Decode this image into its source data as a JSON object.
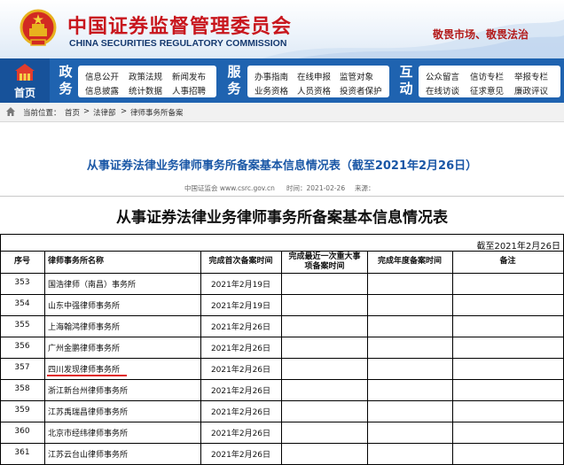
{
  "header": {
    "title_cn": "中国证券监督管理委员会",
    "title_en": "CHINA SECURITIES REGULATORY COMMISSION",
    "slogan": "敬畏市场、敬畏法治"
  },
  "nav": {
    "home_label": "首页",
    "groups": [
      {
        "category": [
          "政",
          "务"
        ],
        "links": [
          "信息公开",
          "政策法规",
          "新闻发布",
          "信息披露",
          "统计数据",
          "人事招聘"
        ]
      },
      {
        "category": [
          "服",
          "务"
        ],
        "links": [
          "办事指南",
          "在线申报",
          "监管对象",
          "业务资格",
          "人员资格",
          "投资者保护"
        ]
      },
      {
        "category": [
          "互",
          "动"
        ],
        "links": [
          "公众留言",
          "信访专栏",
          "举报专栏",
          "在线访谈",
          "征求意见",
          "廉政评议"
        ]
      }
    ]
  },
  "breadcrumb": {
    "items": [
      "当前位置：",
      "首页",
      ">",
      "法律部",
      ">",
      "律师事务所备案"
    ]
  },
  "article": {
    "title": "从事证券法律业务律师事务所备案基本信息情况表（截至2021年2月26日）",
    "source": "中国证监会 www.csrc.gov.cn",
    "time": "时间：2021-02-26",
    "from": "来源："
  },
  "table": {
    "title": "从事证券法律业务律师事务所备案基本信息情况表",
    "as_of": "截至2021年2月26日",
    "headers": [
      "序号",
      "律师事务所名称",
      "完成首次备案时间",
      "完成最近一次重大事项备案时间",
      "完成年度备案时间",
      "备注"
    ],
    "rows": [
      {
        "no": "353",
        "name": "国浩律师（南昌）事务所",
        "first": "2021年2月19日",
        "recent": "",
        "annual": "",
        "note": ""
      },
      {
        "no": "354",
        "name": "山东中强律师事务所",
        "first": "2021年2月19日",
        "recent": "",
        "annual": "",
        "note": ""
      },
      {
        "no": "355",
        "name": "上海翰鸿律师事务所",
        "first": "2021年2月26日",
        "recent": "",
        "annual": "",
        "note": ""
      },
      {
        "no": "356",
        "name": "广州金鹏律师事务所",
        "first": "2021年2月26日",
        "recent": "",
        "annual": "",
        "note": ""
      },
      {
        "no": "357",
        "name": "四川发现律师事务所",
        "first": "2021年2月26日",
        "recent": "",
        "annual": "",
        "note": ""
      },
      {
        "no": "358",
        "name": "浙江新台州律师事务所",
        "first": "2021年2月26日",
        "recent": "",
        "annual": "",
        "note": ""
      },
      {
        "no": "359",
        "name": "江苏禹瑞昌律师事务所",
        "first": "2021年2月26日",
        "recent": "",
        "annual": "",
        "note": ""
      },
      {
        "no": "360",
        "name": "北京市经纬律师事务所",
        "first": "2021年2月26日",
        "recent": "",
        "annual": "",
        "note": ""
      },
      {
        "no": "361",
        "name": "江苏云台山律师事务所",
        "first": "2021年2月26日",
        "recent": "",
        "annual": "",
        "note": ""
      }
    ]
  },
  "colors": {
    "brand_red": "#c8161d",
    "nav_blue": "#1f63b0",
    "title_blue": "#1a57a6",
    "highlight_underline": "#e02020"
  }
}
